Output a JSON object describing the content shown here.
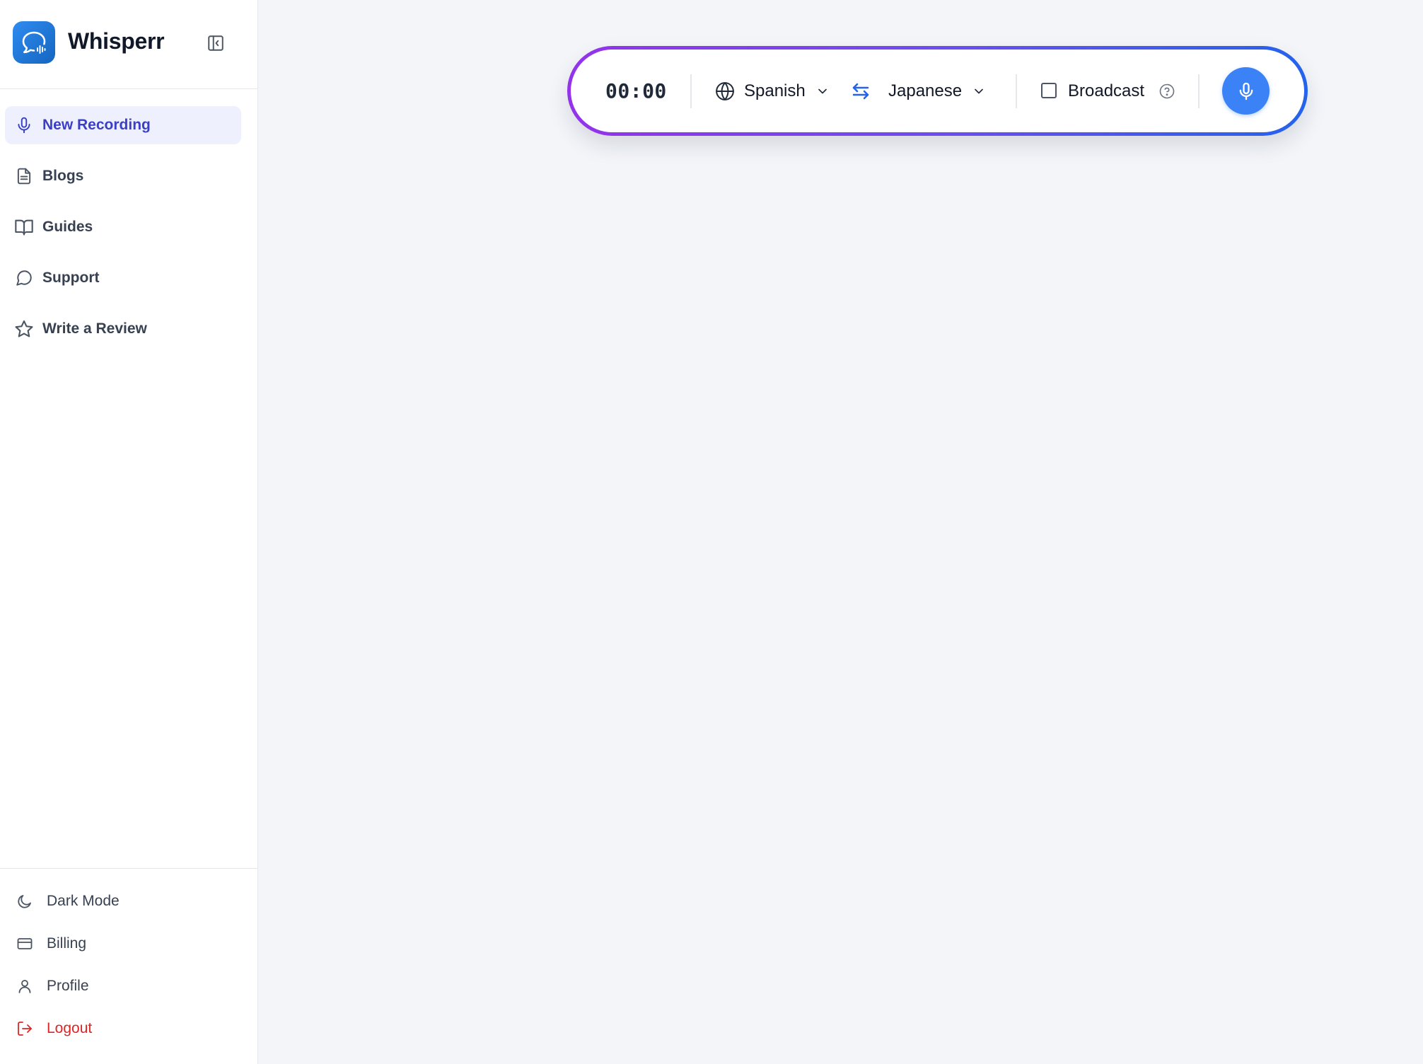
{
  "app": {
    "name": "Whisperr"
  },
  "sidebar": {
    "nav_items": [
      {
        "label": "New Recording",
        "icon": "microphone-icon",
        "active": true
      },
      {
        "label": "Blogs",
        "icon": "document-icon",
        "active": false
      },
      {
        "label": "Guides",
        "icon": "book-open-icon",
        "active": false
      },
      {
        "label": "Support",
        "icon": "chat-bubble-icon",
        "active": false
      },
      {
        "label": "Write a Review",
        "icon": "star-icon",
        "active": false
      }
    ],
    "bottom_items": [
      {
        "label": "Dark Mode",
        "icon": "moon-icon"
      },
      {
        "label": "Billing",
        "icon": "credit-card-icon"
      },
      {
        "label": "Profile",
        "icon": "user-icon"
      },
      {
        "label": "Logout",
        "icon": "logout-icon"
      }
    ]
  },
  "recorder": {
    "timer": "00:00",
    "source_language": "Spanish",
    "target_language": "Japanese",
    "broadcast_label": "Broadcast",
    "broadcast_checked": false
  },
  "colors": {
    "accent_blue": "#3b82f6",
    "active_nav_text": "#3b3fc4",
    "active_nav_bg": "#eef1fd",
    "logout_red": "#dc2626",
    "bar_gradient_start": "#9333ea",
    "bar_gradient_end": "#2563eb"
  }
}
